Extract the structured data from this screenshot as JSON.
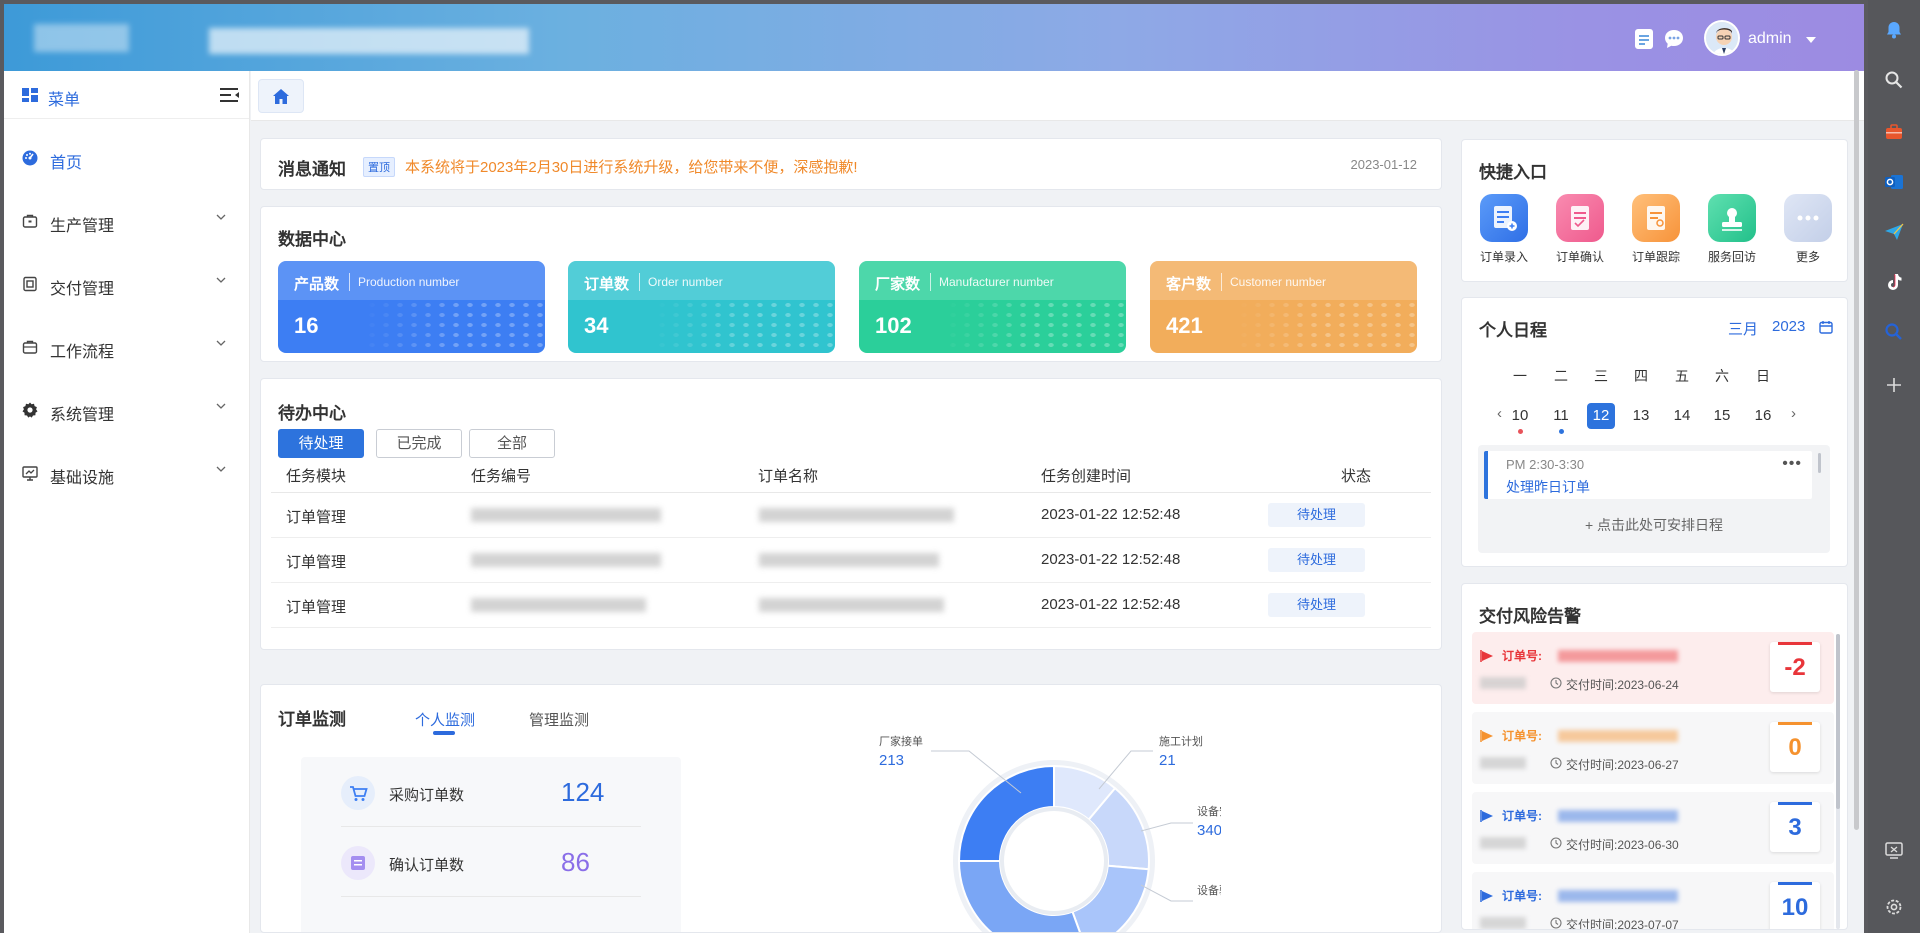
{
  "header": {
    "user_name": "admin"
  },
  "sidebar": {
    "menu_title": "菜单",
    "items": [
      {
        "label": "首页"
      },
      {
        "label": "生产管理"
      },
      {
        "label": "交付管理"
      },
      {
        "label": "工作流程"
      },
      {
        "label": "系统管理"
      },
      {
        "label": "基础设施"
      }
    ]
  },
  "notice": {
    "title": "消息通知",
    "tag": "置顶",
    "text": "本系统将于2023年2月30日进行系统升级，给您带来不便，深感抱歉!",
    "date": "2023-01-12"
  },
  "data_center": {
    "title": "数据中心",
    "stats": [
      {
        "label": "产品数",
        "en": "Production number",
        "value": "16",
        "color": "#3d7ef3"
      },
      {
        "label": "订单数",
        "en": "Order number",
        "value": "34",
        "color": "#30c4cf"
      },
      {
        "label": "厂家数",
        "en": "Manufacturer number",
        "value": "102",
        "color": "#2bcf9a"
      },
      {
        "label": "客户数",
        "en": "Customer number",
        "value": "421",
        "color": "#f2ad5b"
      }
    ]
  },
  "todo": {
    "title": "待办中心",
    "filters": [
      "待处理",
      "已完成",
      "全部"
    ],
    "columns": [
      "任务模块",
      "任务编号",
      "订单名称",
      "任务创建时间",
      "状态"
    ],
    "rows": [
      {
        "module": "订单管理",
        "time": "2023-01-22 12:52:48",
        "status": "待处理"
      },
      {
        "module": "订单管理",
        "time": "2023-01-22 12:52:48",
        "status": "待处理"
      },
      {
        "module": "订单管理",
        "time": "2023-01-22 12:52:48",
        "status": "待处理"
      }
    ]
  },
  "monitor": {
    "title": "订单监测",
    "tabs": [
      "个人监测",
      "管理监测"
    ],
    "stats": [
      {
        "label": "采购订单数",
        "value": "124",
        "color": "#2d6bdd"
      },
      {
        "label": "确认订单数",
        "value": "86",
        "color": "#8a6ee8"
      }
    ]
  },
  "chart_data": {
    "type": "pie",
    "categories": [
      "厂家接单",
      "施工计划",
      "设备安装",
      "设备验收"
    ],
    "values": [
      213,
      21,
      340,
      null
    ]
  },
  "quick_access": {
    "title": "快捷入口",
    "items": [
      {
        "label": "订单录入",
        "icon": "order-entry-icon"
      },
      {
        "label": "订单确认",
        "icon": "order-confirm-icon"
      },
      {
        "label": "订单跟踪",
        "icon": "order-track-icon"
      },
      {
        "label": "服务回访",
        "icon": "service-visit-icon"
      },
      {
        "label": "更多",
        "icon": "more-icon"
      }
    ]
  },
  "schedule": {
    "title": "个人日程",
    "month": "三月",
    "year": "2023",
    "weekdays": [
      "一",
      "二",
      "三",
      "四",
      "五",
      "六",
      "日"
    ],
    "days": [
      "10",
      "11",
      "12",
      "13",
      "14",
      "15",
      "16"
    ],
    "today": "12",
    "event": {
      "time": "PM 2:30-3:30",
      "name": "处理昨日订单"
    },
    "add_label": "+ 点击此处可安排日程"
  },
  "risk": {
    "title": "交付风险告警",
    "order_label": "订单号:",
    "time_label": "交付时间:",
    "items": [
      {
        "date": "2023-06-24",
        "count": "-2",
        "color": "#e8353a",
        "bg": "#fdeded"
      },
      {
        "date": "2023-06-27",
        "count": "0",
        "color": "#f5922e",
        "bg": "#f7f7f8"
      },
      {
        "date": "2023-06-30",
        "count": "3",
        "color": "#2d6bdd",
        "bg": "#f7f7f8"
      },
      {
        "date": "2023-07-07",
        "count": "10",
        "color": "#2d6bdd",
        "bg": "#f7f7f8"
      }
    ]
  }
}
